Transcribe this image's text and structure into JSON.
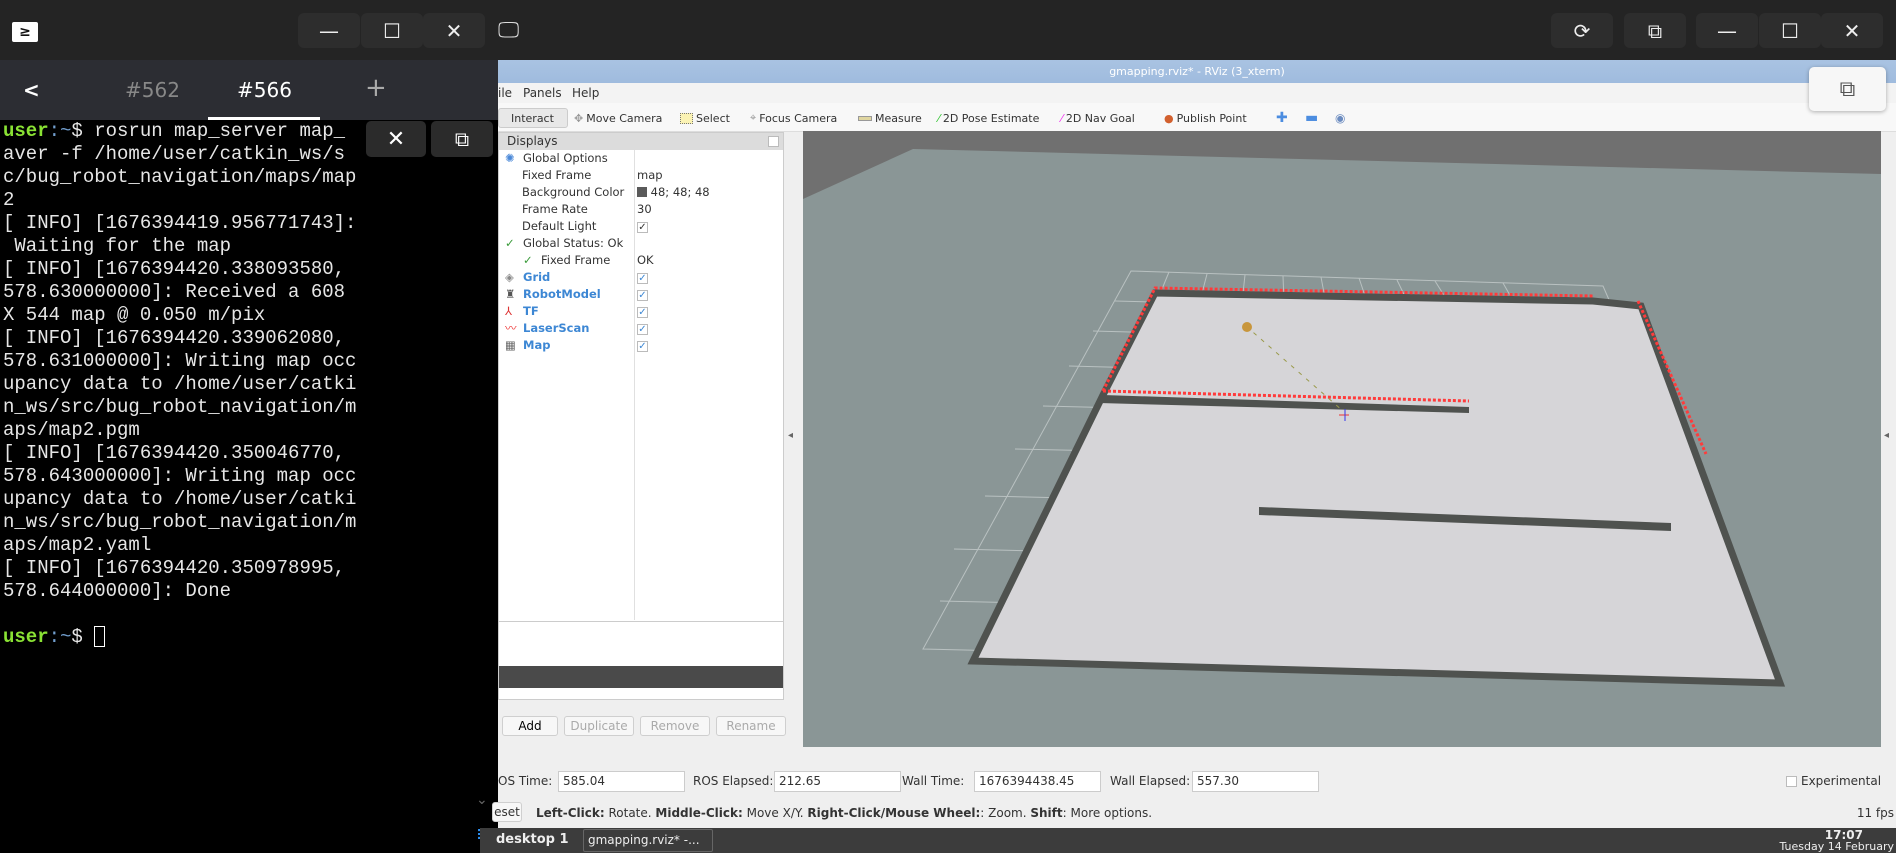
{
  "terminal": {
    "tabs": [
      {
        "label": "#562",
        "active": false
      },
      {
        "label": "#566",
        "active": true
      }
    ],
    "add_tab_label": "+",
    "back_label": "<",
    "prompt_user": "user",
    "prompt_path": ":~",
    "prompt_symbol": "$",
    "lines": [
      " rosrun map_server map_",
      "aver -f /home/user/catkin_ws/s",
      "c/bug_robot_navigation/maps/map",
      "2",
      "[ INFO] [1676394419.956771743]:",
      " Waiting for the map",
      "[ INFO] [1676394420.338093580,",
      "578.630000000]: Received a 608",
      "X 544 map @ 0.050 m/pix",
      "[ INFO] [1676394420.339062080,",
      "578.631000000]: Writing map occ",
      "upancy data to /home/user/catki",
      "n_ws/src/bug_robot_navigation/m",
      "aps/map2.pgm",
      "[ INFO] [1676394420.350046770,",
      "578.643000000]: Writing map occ",
      "upancy data to /home/user/catki",
      "n_ws/src/bug_robot_navigation/m",
      "aps/map2.yaml",
      "[ INFO] [1676394420.350978995,",
      "578.644000000]: Done"
    ]
  },
  "rviz": {
    "window_title": "gmapping.rviz* - RViz (3_xterm)",
    "menu": [
      "ile",
      "Panels",
      "Help"
    ],
    "toolbar": [
      {
        "label": "Interact",
        "icon": "hand-icon"
      },
      {
        "label": "Move Camera",
        "icon": "move-camera-icon"
      },
      {
        "label": "Select",
        "icon": "select-icon"
      },
      {
        "label": "Focus Camera",
        "icon": "focus-camera-icon"
      },
      {
        "label": "Measure",
        "icon": "ruler-icon"
      },
      {
        "label": "2D Pose Estimate",
        "icon": "green-arrow-icon"
      },
      {
        "label": "2D Nav Goal",
        "icon": "pink-arrow-icon"
      },
      {
        "label": "Publish Point",
        "icon": "map-pin-icon"
      }
    ],
    "displays": {
      "header": "Displays",
      "global_options": "Global Options",
      "props": [
        {
          "key": "Fixed Frame",
          "value": "map"
        },
        {
          "key": "Background Color",
          "value": "48; 48; 48",
          "swatch": "#303030"
        },
        {
          "key": "Frame Rate",
          "value": "30"
        },
        {
          "key": "Default Light",
          "value": "✓"
        }
      ],
      "global_status": "Global Status: Ok",
      "fixed_frame_status": {
        "key": "Fixed Frame",
        "value": "OK"
      },
      "items": [
        {
          "label": "Grid",
          "checked": "✓"
        },
        {
          "label": "RobotModel",
          "checked": "✓"
        },
        {
          "label": "TF",
          "checked": "✓"
        },
        {
          "label": "LaserScan",
          "checked": "✓"
        },
        {
          "label": "Map",
          "checked": "✓"
        }
      ],
      "buttons": [
        "Add",
        "Duplicate",
        "Remove",
        "Rename"
      ]
    },
    "time": {
      "ros_time_label": "OS Time:",
      "ros_time": "585.04",
      "ros_elapsed_label": "ROS Elapsed:",
      "ros_elapsed": "212.65",
      "wall_time_label": "Wall Time:",
      "wall_time": "1676394438.45",
      "wall_elapsed_label": "Wall Elapsed:",
      "wall_elapsed": "557.30",
      "experimental": "Experimental"
    },
    "reset_label": "eset",
    "hint": [
      {
        "b": "Left-Click:",
        "t": " Rotate. "
      },
      {
        "b": "Middle-Click:",
        "t": " Move X/Y. "
      },
      {
        "b": "Right-Click/Mouse Wheel:",
        "t": ": Zoom. "
      },
      {
        "b": "Shift",
        "t": ": More options."
      }
    ],
    "fps": "11 fps",
    "colors": {
      "laser": "#ff3b3b",
      "map_free": "#d6d5d8",
      "map_wall": "#4f524f",
      "unknown": "#8a9696"
    }
  },
  "taskbar": {
    "desktop": "desktop 1",
    "task": "gmapping.rviz* -...",
    "time": "17:07",
    "date": "Tuesday 14 February"
  }
}
